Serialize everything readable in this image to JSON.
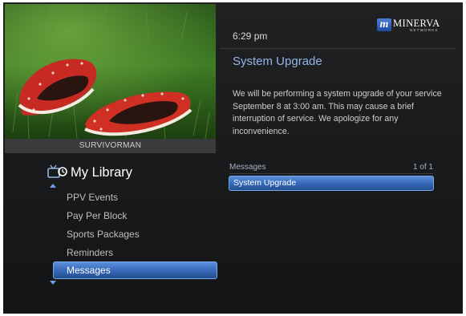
{
  "header": {
    "time": "6:29 pm",
    "brand": {
      "mark": "m",
      "name": "MINERVA",
      "sub": "NETWORKS"
    }
  },
  "preview": {
    "caption": "SURVIVORMAN"
  },
  "library": {
    "title": "My Library",
    "icon": "tv-icon",
    "items": [
      {
        "label": "PPV Events"
      },
      {
        "label": "Pay Per Block"
      },
      {
        "label": "Sports Packages"
      },
      {
        "label": "Reminders"
      },
      {
        "label": "Messages"
      }
    ],
    "selected_index": 4
  },
  "message": {
    "title": "System Upgrade",
    "body": "We will be performing a system upgrade of your service September 8 at 3:00 am. This may cause a brief interruption of service. We apologize for any inconvenience."
  },
  "messages_list": {
    "header": "Messages",
    "count": "1 of 1",
    "items": [
      {
        "label": "System Upgrade"
      }
    ]
  },
  "colors": {
    "accent_blue": "#3566b7",
    "title_blue": "#8fb6e8",
    "background": "#1c1d1f"
  }
}
